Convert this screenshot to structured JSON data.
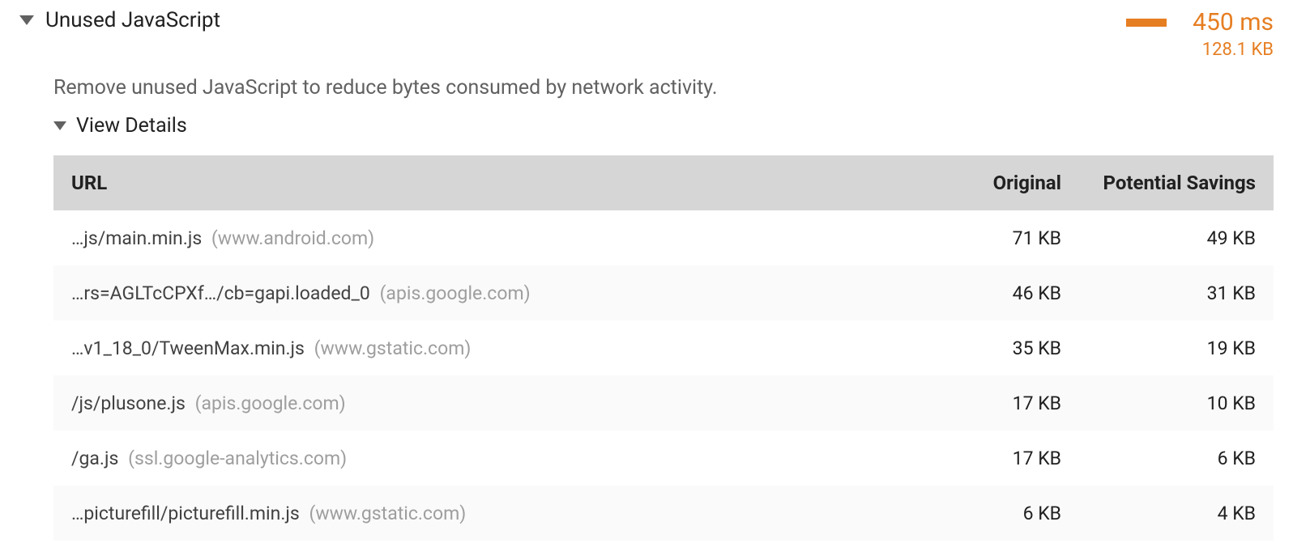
{
  "audit": {
    "title": "Unused JavaScript",
    "metric_time": "450 ms",
    "metric_size": "128.1 KB",
    "description": "Remove unused JavaScript to reduce bytes consumed by network activity.",
    "view_details_label": "View Details",
    "columns": {
      "url": "URL",
      "original": "Original",
      "savings": "Potential Savings"
    },
    "rows": [
      {
        "path": "…js/main.min.js",
        "domain": "(www.android.com)",
        "original": "71 KB",
        "savings": "49 KB"
      },
      {
        "path": "…rs=AGLTcCPXf…/cb=gapi.loaded_0",
        "domain": "(apis.google.com)",
        "original": "46 KB",
        "savings": "31 KB"
      },
      {
        "path": "…v1_18_0/TweenMax.min.js",
        "domain": "(www.gstatic.com)",
        "original": "35 KB",
        "savings": "19 KB"
      },
      {
        "path": "/js/plusone.js",
        "domain": "(apis.google.com)",
        "original": "17 KB",
        "savings": "10 KB"
      },
      {
        "path": "/ga.js",
        "domain": "(ssl.google-analytics.com)",
        "original": "17 KB",
        "savings": "6 KB"
      },
      {
        "path": "…picturefill/picturefill.min.js",
        "domain": "(www.gstatic.com)",
        "original": "6 KB",
        "savings": "4 KB"
      }
    ]
  }
}
